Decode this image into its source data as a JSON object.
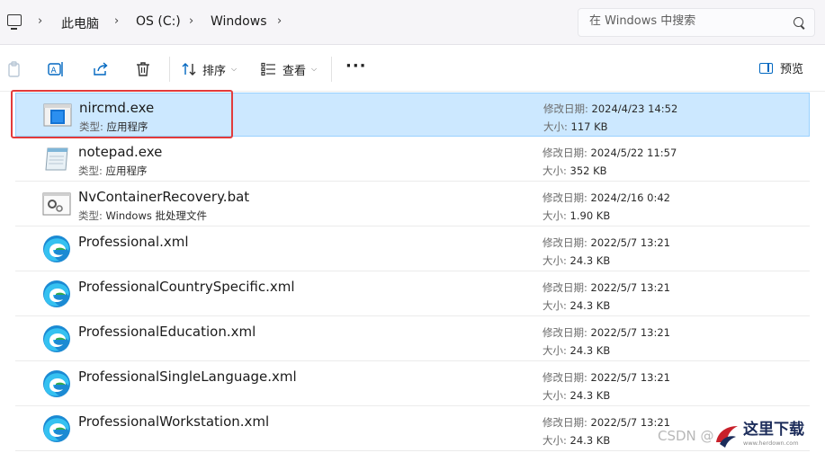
{
  "address_bar": {
    "crumbs": [
      "此电脑",
      "OS (C:)",
      "Windows"
    ],
    "search_placeholder": "在 Windows 中搜索"
  },
  "toolbar": {
    "sort_label": "排序",
    "view_label": "查看",
    "more_label": "···",
    "preview_label": "预览"
  },
  "files": [
    {
      "name": "nircmd.exe",
      "type_label": "类型:",
      "type": "应用程序",
      "date_label": "修改日期:",
      "date": "2024/4/23 14:52",
      "size_label": "大小:",
      "size": "117 KB",
      "icon": "app-window-icon",
      "selected": true
    },
    {
      "name": "notepad.exe",
      "type_label": "类型:",
      "type": "应用程序",
      "date_label": "修改日期:",
      "date": "2024/5/22 11:57",
      "size_label": "大小:",
      "size": "352 KB",
      "icon": "notepad-icon"
    },
    {
      "name": "NvContainerRecovery.bat",
      "type_label": "类型:",
      "type": "Windows 批处理文件",
      "date_label": "修改日期:",
      "date": "2024/2/16 0:42",
      "size_label": "大小:",
      "size": "1.90 KB",
      "icon": "batch-file-icon"
    },
    {
      "name": "Professional.xml",
      "date_label": "修改日期:",
      "date": "2022/5/7 13:21",
      "size_label": "大小:",
      "size": "24.3 KB",
      "icon": "edge-icon"
    },
    {
      "name": "ProfessionalCountrySpecific.xml",
      "date_label": "修改日期:",
      "date": "2022/5/7 13:21",
      "size_label": "大小:",
      "size": "24.3 KB",
      "icon": "edge-icon"
    },
    {
      "name": "ProfessionalEducation.xml",
      "date_label": "修改日期:",
      "date": "2022/5/7 13:21",
      "size_label": "大小:",
      "size": "24.3 KB",
      "icon": "edge-icon"
    },
    {
      "name": "ProfessionalSingleLanguage.xml",
      "date_label": "修改日期:",
      "date": "2022/5/7 13:21",
      "size_label": "大小:",
      "size": "24.3 KB",
      "icon": "edge-icon"
    },
    {
      "name": "ProfessionalWorkstation.xml",
      "date_label": "修改日期:",
      "date": "2022/5/7 13:21",
      "size_label": "大小:",
      "size": "24.3 KB",
      "icon": "edge-icon"
    }
  ],
  "watermark": {
    "csdn": "CSDN @",
    "site": "这里下载",
    "site_url": "www.herdown.com"
  },
  "colors": {
    "selection_bg": "#cce8ff",
    "accent": "#0067c0",
    "highlight_border": "#e23b3b"
  }
}
